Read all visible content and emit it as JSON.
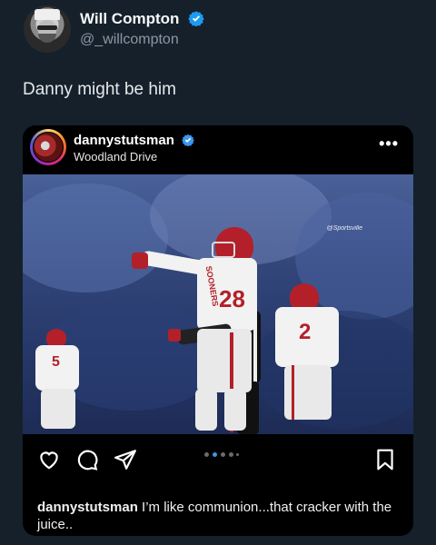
{
  "tweet": {
    "author": {
      "display_name": "Will Compton",
      "handle": "@_willcompton",
      "verified": true
    },
    "text": "Danny might be him"
  },
  "instagram_post": {
    "username": "dannystutsman",
    "verified": true,
    "location": "Woodland Drive",
    "more_icon": "more-horizontal-icon",
    "watermark": "@Sportsville",
    "photo": {
      "player_front_number": "28",
      "jersey_text": "SOONERS",
      "player_back_number": "2",
      "player_left_number": "5"
    },
    "carousel": {
      "count": 5,
      "active_index": 1
    },
    "actions": [
      "heart-icon",
      "comment-icon",
      "share-icon",
      "bookmark-icon"
    ],
    "caption": {
      "username": "dannystutsman",
      "text": " I’m like communion...that cracker with the juice.."
    }
  },
  "colors": {
    "background": "#15202b",
    "card": "#000000",
    "verified_blue": "#1d9bf0",
    "carousel_active": "#3897f0",
    "oklahoma_crimson": "#b3202a"
  }
}
